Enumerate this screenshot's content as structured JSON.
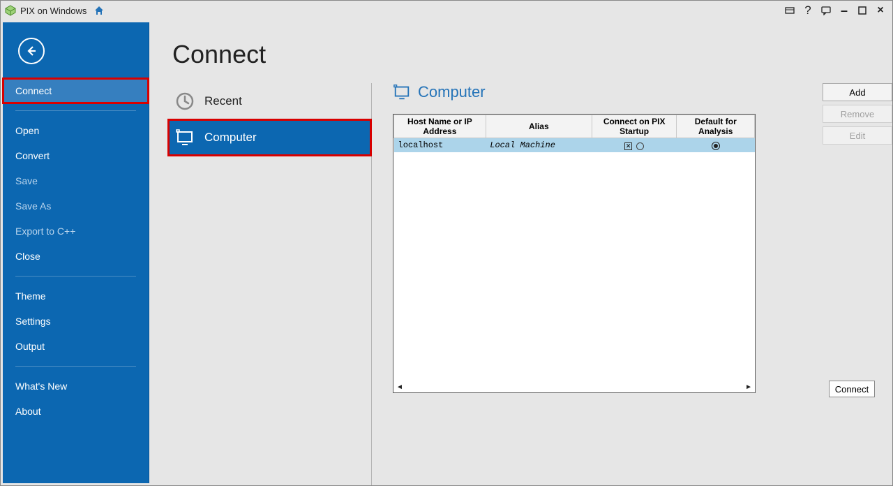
{
  "app": {
    "title": "PIX on Windows"
  },
  "sidebar": {
    "items": [
      {
        "label": "Connect",
        "active": true,
        "highlighted": true
      },
      {
        "label": "Open"
      },
      {
        "label": "Convert"
      },
      {
        "label": "Save",
        "dim": true
      },
      {
        "label": "Save As",
        "dim": true
      },
      {
        "label": "Export to C++",
        "dim": true
      },
      {
        "label": "Close"
      },
      {
        "label": "Theme"
      },
      {
        "label": "Settings"
      },
      {
        "label": "Output"
      },
      {
        "label": "What's New"
      },
      {
        "label": "About"
      }
    ]
  },
  "page": {
    "title": "Connect",
    "categories": {
      "recent": "Recent",
      "computer": "Computer"
    }
  },
  "panel": {
    "title": "Computer",
    "columns": {
      "host": "Host Name or IP Address",
      "alias": "Alias",
      "connect_on_startup": "Connect on PIX Startup",
      "default_for_analysis": "Default for Analysis"
    },
    "rows": [
      {
        "host": "localhost",
        "alias": "Local Machine",
        "connect_on_startup": true,
        "default_for_analysis": true
      }
    ],
    "buttons": {
      "add": "Add",
      "remove": "Remove",
      "edit": "Edit",
      "connect": "Connect"
    }
  }
}
